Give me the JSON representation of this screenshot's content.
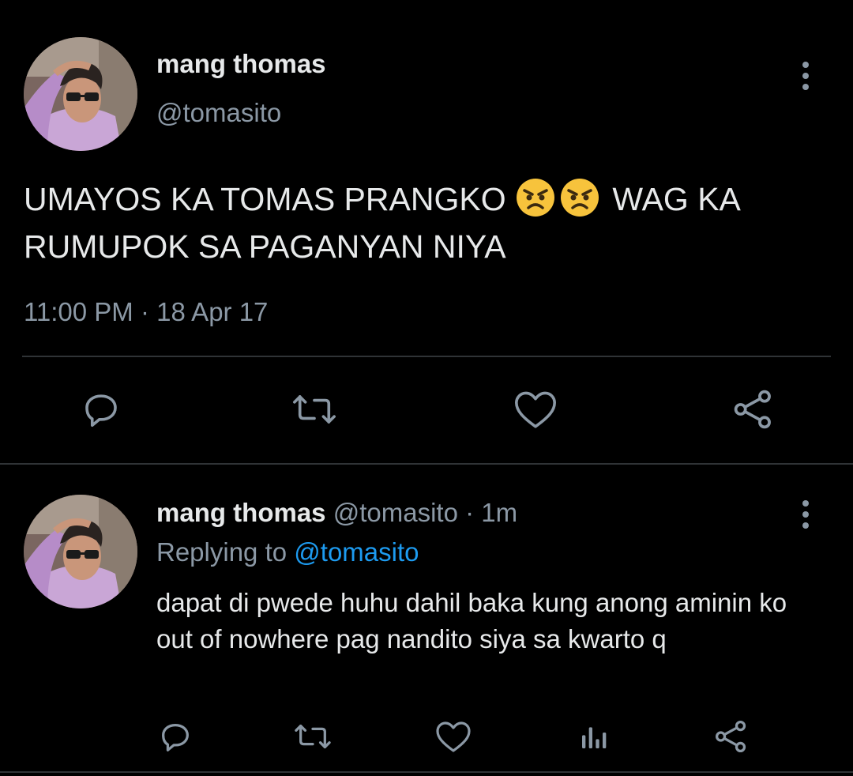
{
  "main_tweet": {
    "author_name": "mang thomas",
    "author_handle": "@tomasito",
    "text_part1": "UMAYOS KA TOMAS PRANGKO ",
    "text_part2": " WAG KA RUMUPOK SA PAGANYAN NIYA",
    "emojis": [
      "angry-face",
      "angry-face"
    ],
    "timestamp": "11:00 PM · 18 Apr 17",
    "actions": [
      "reply-icon",
      "retweet-icon",
      "like-icon",
      "share-icon"
    ]
  },
  "reply_tweet": {
    "author_name": "mang thomas",
    "author_handle": "@tomasito",
    "separator": "·",
    "time_ago": "1m",
    "replying_prefix": "Replying to",
    "replying_handle": "@tomasito",
    "text": "dapat di pwede huhu dahil baka kung anong aminin ko out of nowhere pag nandito siya sa kwarto q",
    "actions": [
      "reply-icon",
      "retweet-icon",
      "like-icon",
      "analytics-icon",
      "share-icon"
    ]
  },
  "colors": {
    "background": "#000000",
    "text": "#e7e9ea",
    "secondary": "#8b98a5",
    "link": "#1d9bf0",
    "divider": "#2f3336"
  }
}
